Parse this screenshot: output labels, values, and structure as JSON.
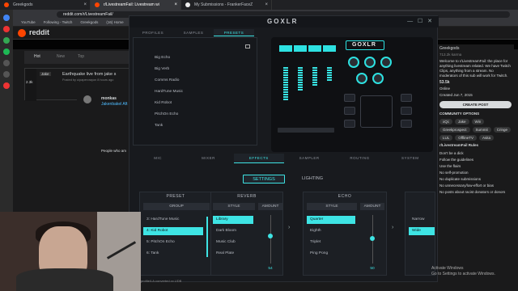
{
  "browser": {
    "tabs": [
      {
        "label": "Greekgods",
        "active": false
      },
      {
        "label": "r/LivestreamFail: Livestream wi",
        "active": true
      },
      {
        "label": "My Submissions - FrankerFaceZ",
        "active": false
      }
    ],
    "url": "reddit.com/r/LivestreamFail/",
    "bookmarks": [
      "YouTube",
      "Following - Twitch",
      "Greekgods",
      "(16) Home"
    ]
  },
  "reddit": {
    "logo_text": "reddit",
    "subreddit": "r/LivestreamFail",
    "sort": [
      "Hot",
      "New",
      "Top"
    ],
    "post": {
      "score": "2.3k",
      "author_tag": "Jake",
      "title": "Earthquake live from jake s",
      "meta": "Posted by u/papercrayon 8 hours ago"
    },
    "comment_user": "monkas",
    "comment_text": "Jakenbakel Aft",
    "comment_extra": "People who am",
    "right": {
      "user": "Greekgods",
      "karma": "713.2k karma",
      "about_text": "Welcome to r/LivestreamFail: the place for anything livestream related. We have Twitch Clips, anything from a stream. No moderators of this sub will work for Twitch.",
      "members": "53.5k",
      "members_label": "Online",
      "created": "Created Jun 7, 2015",
      "create_post": "CREATE POST",
      "community_options": "COMMUNITY OPTIONS",
      "flairs": [
        "xQc",
        "Jake",
        "Win",
        "Greekprospect",
        "Summit",
        "Cringe",
        "LUL",
        "OfflineTV",
        "Asita"
      ],
      "rules_title": "r/LivestreamFail Rules",
      "rules": [
        "Don't be a dick",
        "Follow the guidelines",
        "Use the flairs",
        "No self-promotion",
        "No duplicate submissions",
        "No unnecessary/low-effort or bias",
        "No posts about racist donators or donors"
      ]
    }
  },
  "goxlr": {
    "logo": "GOXLR",
    "top_tabs": [
      {
        "label": "PROFILES",
        "active": false
      },
      {
        "label": "SAMPLES",
        "active": false
      },
      {
        "label": "PRESETS",
        "active": true
      }
    ],
    "presets": [
      "Big Echo",
      "Big Verb",
      "Comms Radio",
      "HardTune Music",
      "Kid Robot",
      "PitchOn Echo",
      "Tank"
    ],
    "mixer_tabs": [
      {
        "label": "MIC",
        "active": false
      },
      {
        "label": "MIXER",
        "active": false
      },
      {
        "label": "EFFECTS",
        "active": true
      },
      {
        "label": "SAMPLER",
        "active": false
      },
      {
        "label": "ROUTING",
        "active": false
      },
      {
        "label": "SYSTEM",
        "active": false
      }
    ],
    "sub_tabs": {
      "settings": "SETTINGS",
      "lighting": "LIGHTING"
    },
    "preset_section": {
      "title": "PRESET",
      "column": "GROUP",
      "items": [
        "3: HardTune Music",
        "4: Kid Robot",
        "5: PitchOn Echo",
        "6: Tank"
      ],
      "selected_index": 1
    },
    "reverb_section": {
      "title": "REVERB",
      "style_label": "STYLE",
      "amount_label": "AMOUNT",
      "items": [
        "Library",
        "Dark Bloom",
        "Music Club",
        "Real Plate"
      ],
      "selected_index": 0,
      "amount": "54"
    },
    "echo_section": {
      "title": "ECHO",
      "style_label": "STYLE",
      "amount_label": "AMOUNT",
      "items": [
        "Quarter",
        "Eighth",
        "Triplet",
        "Ping Pong"
      ],
      "selected_index": 0,
      "amount": "50"
    },
    "pitch_section": {
      "items": [
        "Narrow",
        "Wide"
      ],
      "selected_index": 1
    },
    "accent": "#3ee4e4"
  },
  "windows": {
    "activate_title": "Activate Windows",
    "activate_sub": "Go to Settings to activate Windows."
  },
  "status": "profile/LA.converted.xx.UDB"
}
